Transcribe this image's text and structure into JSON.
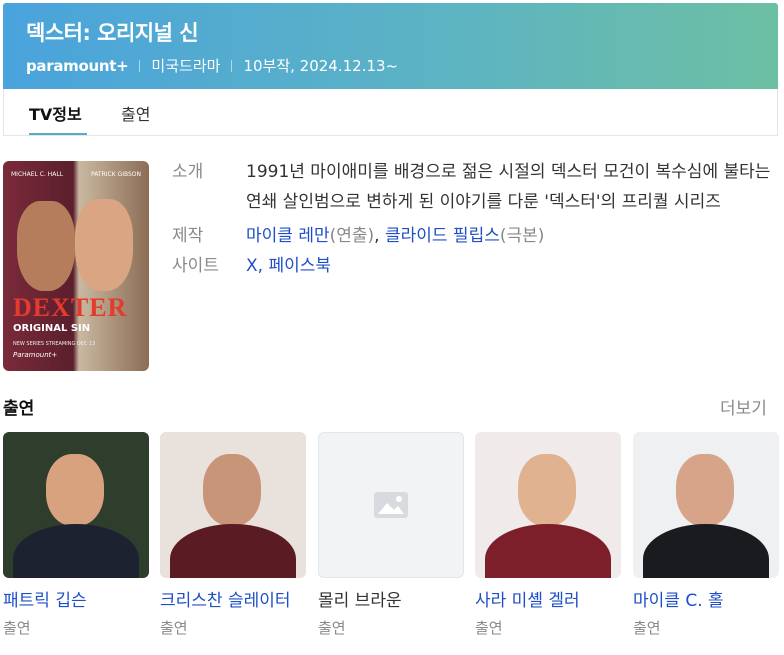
{
  "header": {
    "title": "덱스터: 오리지널 신",
    "network": "paramount+",
    "genre": "미국드라마",
    "episodes_date": "10부작, 2024.12.13~"
  },
  "tabs": [
    {
      "label": "TV정보",
      "active": true
    },
    {
      "label": "출연",
      "active": false
    }
  ],
  "poster": {
    "actor_left": "MICHAEL C. HALL",
    "actor_right": "PATRICK GIBSON",
    "logo": "DEXTER",
    "subtitle": "ORIGINAL SIN",
    "tagline": "NEW SERIES STREAMING DEC 13",
    "brand": "Paramount+"
  },
  "info": {
    "intro_label": "소개",
    "intro_text": "1991년 마이애미를 배경으로 젊은 시절의 덱스터 모건이 복수심에 불타는 연쇄 살인범으로 변하게 된 이야기를 다룬 '덱스터'의 프리퀄 시리즈",
    "production_label": "제작",
    "director_name": "마이클 레만",
    "director_role": "(연출)",
    "writer_name": "클라이드 필립스",
    "writer_role": "(극본)",
    "site_label": "사이트",
    "site_x": "X",
    "site_facebook": "페이스북"
  },
  "cast_section": {
    "title": "출연",
    "more": "더보기",
    "members": [
      {
        "name": "패트릭 깁슨",
        "role": "출연",
        "has_photo": true
      },
      {
        "name": "크리스찬 슬레이터",
        "role": "출연",
        "has_photo": true
      },
      {
        "name": "몰리 브라운",
        "role": "출연",
        "has_photo": false
      },
      {
        "name": "사라 미셸 겔러",
        "role": "출연",
        "has_photo": true
      },
      {
        "name": "마이클 C. 홀",
        "role": "출연",
        "has_photo": true
      }
    ]
  },
  "colors": {
    "header_gradient_start": "#4aa3dc",
    "header_gradient_end": "#6dbfa3",
    "link": "#1e4fc8",
    "tab_underline": "#5aa9c8"
  }
}
